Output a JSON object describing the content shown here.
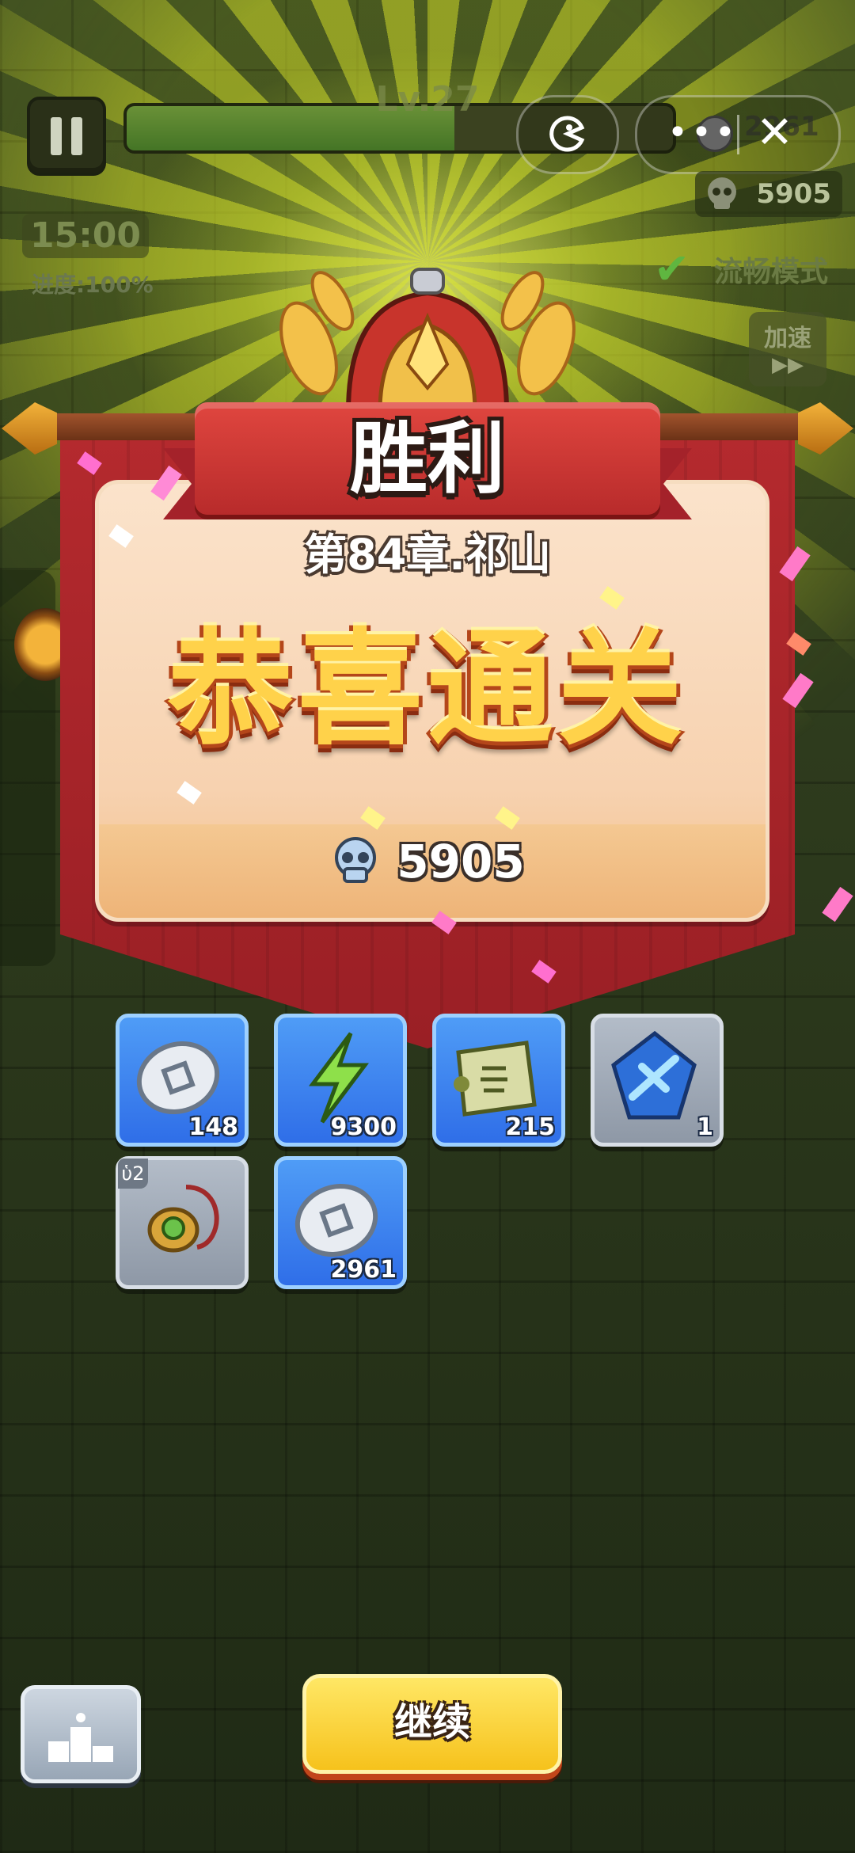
{
  "hud": {
    "level": "Lv.27",
    "coins": "2961",
    "skulls": "5905",
    "timer": "15:00",
    "progress": "进度:100%",
    "smooth_mode": "流畅模式",
    "speed_label": "加速",
    "speed_arrows": "▶▶"
  },
  "result": {
    "title": "胜利",
    "chapter": "第84章.祁山",
    "congrats": "恭喜通关",
    "score": "5905"
  },
  "rewards": [
    {
      "icon": "silver-coin-icon",
      "qty": "148"
    },
    {
      "icon": "energy-bolt-icon",
      "qty": "9300"
    },
    {
      "icon": "scroll-icon",
      "qty": "215"
    },
    {
      "icon": "sword-gem-icon",
      "qty": "1"
    },
    {
      "icon": "amulet-icon",
      "qty": ""
    },
    {
      "icon": "silver-coin-icon",
      "qty": "2961"
    }
  ],
  "buttons": {
    "continue": "继续"
  },
  "colors": {
    "banner_red": "#b52a2e",
    "gold": "#ffd24a",
    "reward_blue": "#3a7ff0",
    "reward_grey": "#a0aab6",
    "continue_yellow": "#fcd63a"
  }
}
